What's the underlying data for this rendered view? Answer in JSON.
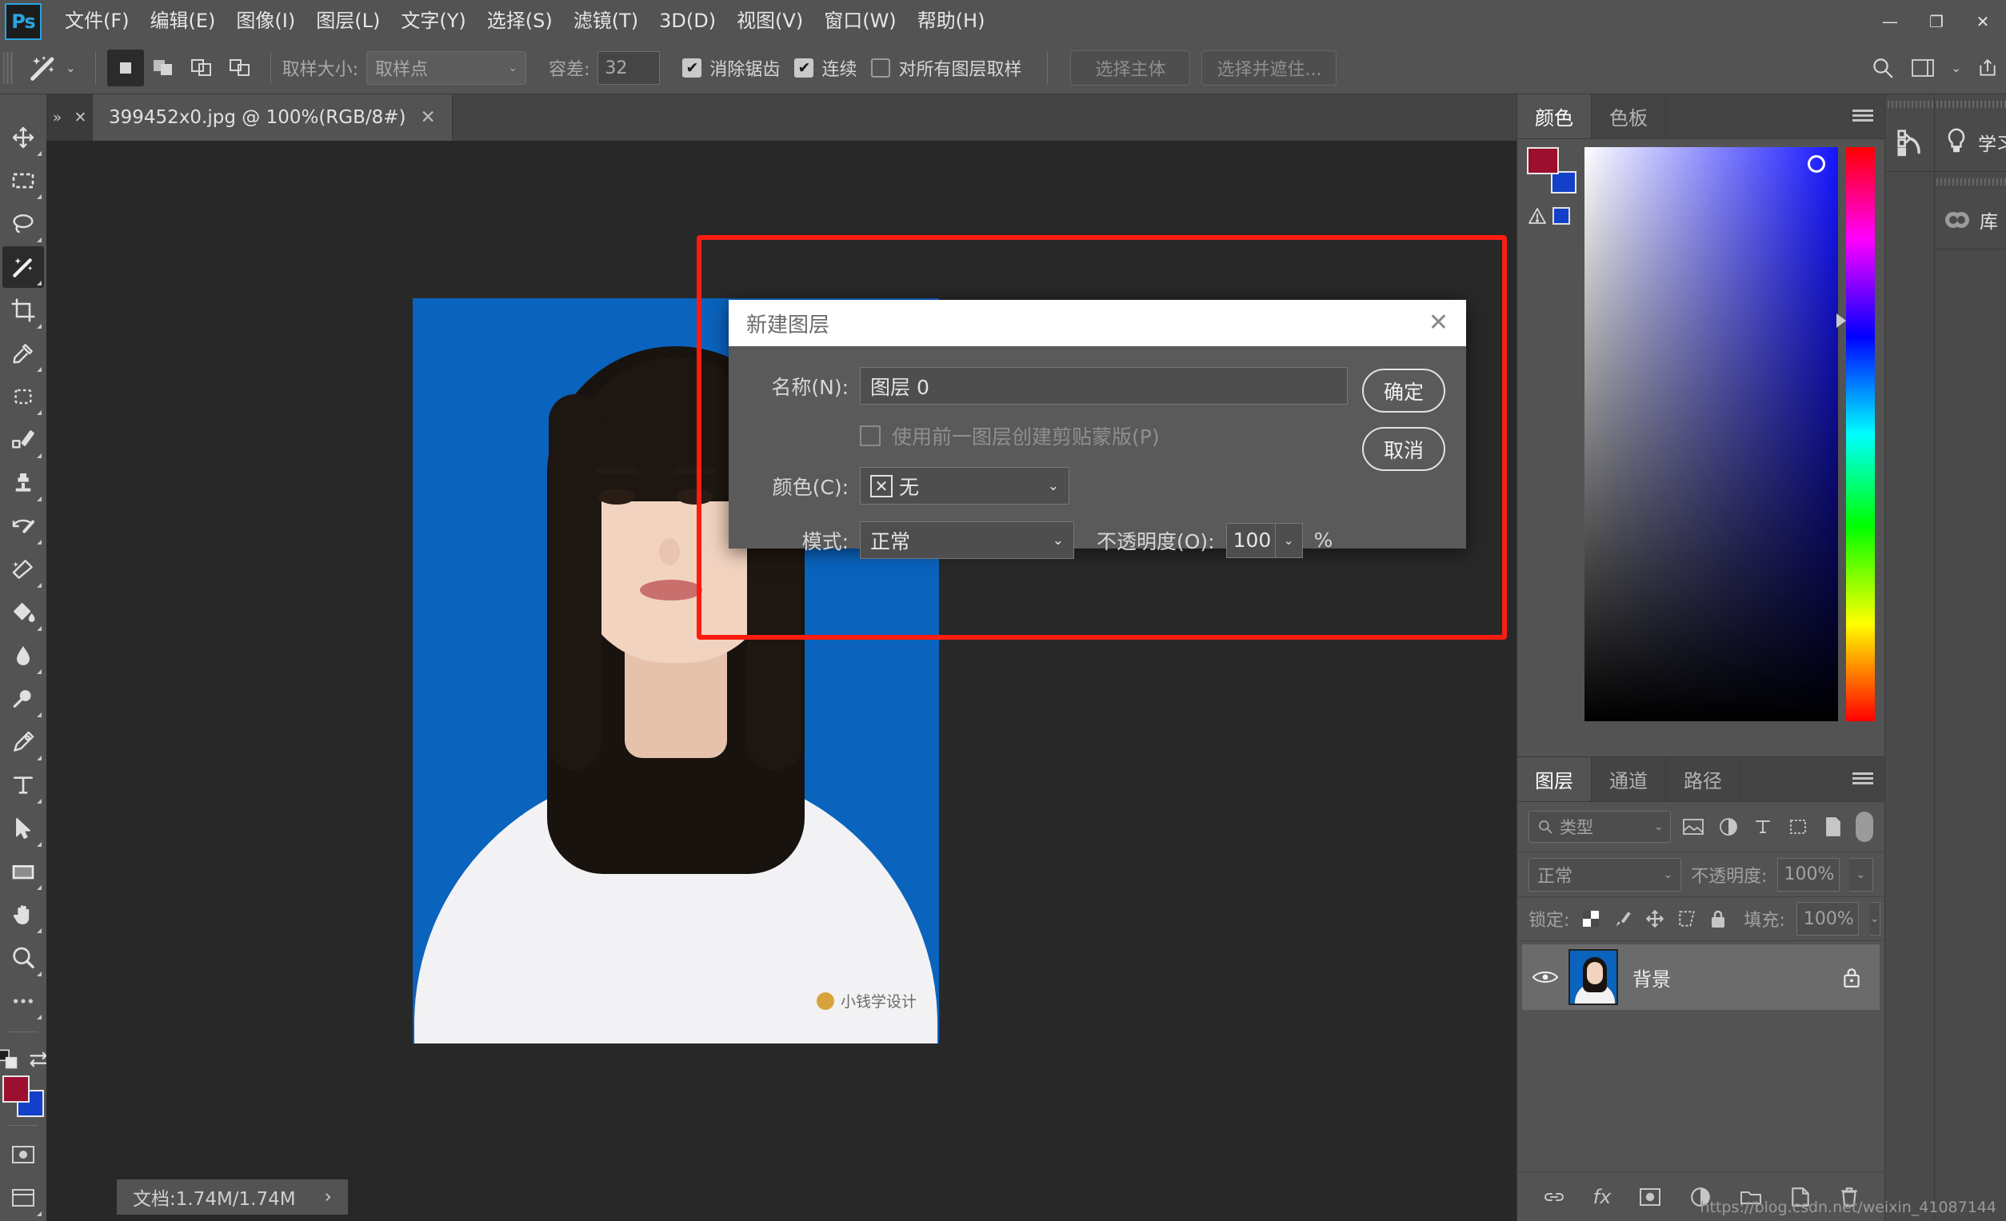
{
  "app": {
    "logo": "Ps"
  },
  "menubar": {
    "items": [
      {
        "label": "文件(F)"
      },
      {
        "label": "编辑(E)"
      },
      {
        "label": "图像(I)"
      },
      {
        "label": "图层(L)"
      },
      {
        "label": "文字(Y)"
      },
      {
        "label": "选择(S)"
      },
      {
        "label": "滤镜(T)"
      },
      {
        "label": "3D(D)"
      },
      {
        "label": "视图(V)"
      },
      {
        "label": "窗口(W)"
      },
      {
        "label": "帮助(H)"
      }
    ],
    "window_controls": {
      "minimize": "—",
      "maximize": "❐",
      "close": "✕"
    }
  },
  "options_bar": {
    "tool_icon": "magic-wand-icon",
    "selection_modes": [
      "new-selection",
      "add-to-selection",
      "subtract-from-selection",
      "intersect-selection"
    ],
    "sample_size_label": "取样大小:",
    "sample_size_value": "取样点",
    "tolerance_label": "容差:",
    "tolerance_value": "32",
    "antialias_label": "消除锯齿",
    "antialias_checked": true,
    "contiguous_label": "连续",
    "contiguous_checked": true,
    "sample_all_layers_label": "对所有图层取样",
    "sample_all_layers_checked": false,
    "select_subject_label": "选择主体",
    "select_and_mask_label": "选择并遮住..."
  },
  "toolbar": {
    "tools": [
      {
        "name": "move-tool"
      },
      {
        "name": "marquee-tool"
      },
      {
        "name": "lasso-tool"
      },
      {
        "name": "magic-wand-tool",
        "active": true
      },
      {
        "name": "crop-tool"
      },
      {
        "name": "eyedropper-tool"
      },
      {
        "name": "patch-tool"
      },
      {
        "name": "brush-tool"
      },
      {
        "name": "clone-stamp-tool"
      },
      {
        "name": "history-brush-tool"
      },
      {
        "name": "eraser-tool"
      },
      {
        "name": "paint-bucket-tool"
      },
      {
        "name": "blur-tool"
      },
      {
        "name": "dodge-tool"
      },
      {
        "name": "pen-tool"
      },
      {
        "name": "type-tool"
      },
      {
        "name": "path-selection-tool"
      },
      {
        "name": "rectangle-tool"
      },
      {
        "name": "hand-tool"
      },
      {
        "name": "zoom-tool"
      },
      {
        "name": "more-tools"
      }
    ],
    "foreground_color": "#9c0f2e",
    "background_color": "#1340c8"
  },
  "document_tab": {
    "title": "399452x0.jpg @ 100%(RGB/8#)",
    "close": "✕",
    "overflow": "»",
    "panel_close": "✕"
  },
  "dialog": {
    "title": "新建图层",
    "close": "✕",
    "name_label": "名称(N):",
    "name_value": "图层 0",
    "clipping_mask_label": "使用前一图层创建剪贴蒙版(P)",
    "clipping_mask_checked": false,
    "color_label": "颜色(C):",
    "color_value": "无",
    "color_swatch_glyph": "✕",
    "mode_label": "模式:",
    "mode_value": "正常",
    "opacity_label": "不透明度(O):",
    "opacity_value": "100",
    "percent": "%",
    "ok_label": "确定",
    "cancel_label": "取消"
  },
  "annotation": {
    "color": "#fc1d10"
  },
  "canvas": {
    "background_color": "#0a63bd",
    "watermark": "小钱学设计"
  },
  "right_rail": {
    "history_icon": "history-icon",
    "items": [
      {
        "label": "学习",
        "icon": "lightbulb-icon"
      },
      {
        "label": "库",
        "icon": "cc-libraries-icon"
      }
    ]
  },
  "color_panel": {
    "tabs": [
      {
        "label": "颜色",
        "active": true
      },
      {
        "label": "色板",
        "active": false
      }
    ],
    "foreground_color": "#9c0f2e",
    "background_color": "#1340c8",
    "warning_icon": "out-of-gamut-warning-icon"
  },
  "layers_panel": {
    "tabs": [
      {
        "label": "图层",
        "active": true
      },
      {
        "label": "通道",
        "active": false
      },
      {
        "label": "路径",
        "active": false
      }
    ],
    "filter_placeholder": "类型",
    "filter_icons": [
      "pixel-filter-icon",
      "adjustment-filter-icon",
      "type-filter-icon",
      "shape-filter-icon",
      "smart-object-filter-icon"
    ],
    "blend_mode": "正常",
    "opacity_label": "不透明度:",
    "opacity_value": "100%",
    "lock_label": "锁定:",
    "lock_icons": [
      "lock-transparent-pixels-icon",
      "lock-image-pixels-icon",
      "lock-position-icon",
      "lock-artboard-icon",
      "lock-all-icon"
    ],
    "fill_label": "填充:",
    "fill_value": "100%",
    "layers": [
      {
        "name": "背景",
        "visible": true,
        "locked": true
      }
    ],
    "bottom_icons": [
      "link-layers-icon",
      "layer-style-icon",
      "layer-mask-icon",
      "adjustment-layer-icon",
      "new-group-icon",
      "new-layer-icon",
      "delete-layer-icon"
    ],
    "layer_style_label": "fx"
  },
  "status_bar": {
    "doc_size": "文档:1.74M/1.74M",
    "expand": "›"
  },
  "page_watermark": "https://blog.csdn.net/weixin_41087144"
}
